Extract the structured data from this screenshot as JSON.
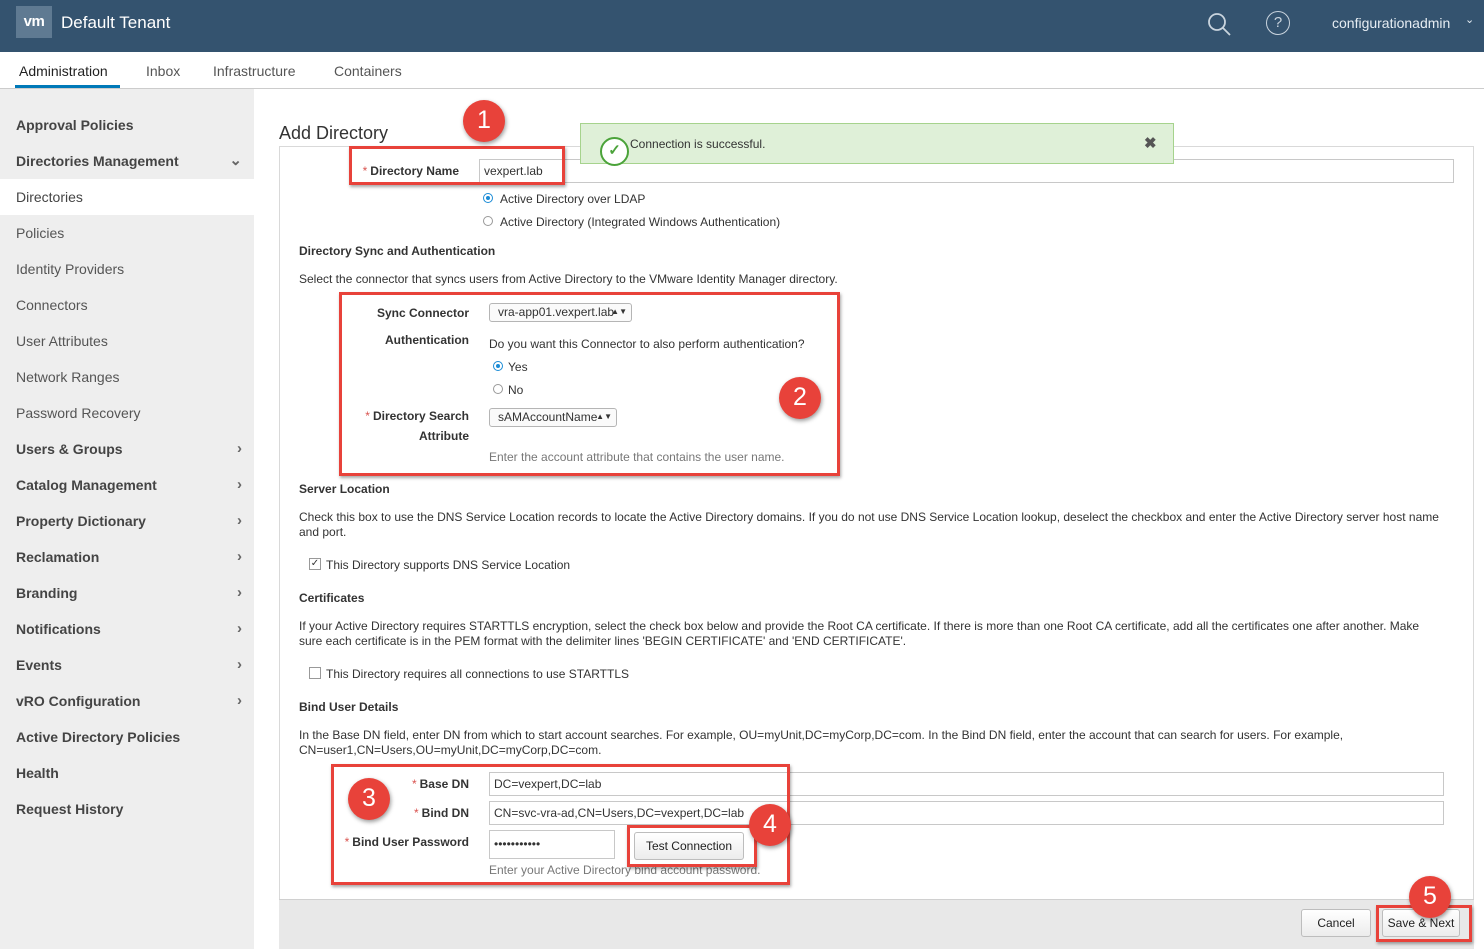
{
  "header": {
    "logo": "vm",
    "tenant": "Default Tenant",
    "search_icon": "search-icon",
    "help_icon": "help-icon",
    "help_glyph": "?",
    "username": "configurationadmin",
    "user_chevron": "⌄",
    "brand_color": "#34536f"
  },
  "tabs": [
    {
      "label": "Administration",
      "active": true
    },
    {
      "label": "Inbox"
    },
    {
      "label": "Infrastructure"
    },
    {
      "label": "Containers"
    }
  ],
  "sidebar": {
    "items": [
      {
        "label": "Approval Policies",
        "bold": true
      },
      {
        "label": "Directories Management",
        "bold": true,
        "chevron": "⌄"
      },
      {
        "label": "Directories",
        "selected": true
      },
      {
        "label": "Policies"
      },
      {
        "label": "Identity Providers"
      },
      {
        "label": "Connectors"
      },
      {
        "label": "User Attributes"
      },
      {
        "label": "Network Ranges"
      },
      {
        "label": "Password Recovery"
      },
      {
        "label": "Users & Groups",
        "bold": true,
        "chevron": "›"
      },
      {
        "label": "Catalog Management",
        "bold": true,
        "chevron": "›"
      },
      {
        "label": "Property Dictionary",
        "bold": true,
        "chevron": "›"
      },
      {
        "label": "Reclamation",
        "bold": true,
        "chevron": "›"
      },
      {
        "label": "Branding",
        "bold": true,
        "chevron": "›"
      },
      {
        "label": "Notifications",
        "bold": true,
        "chevron": "›"
      },
      {
        "label": "Events",
        "bold": true,
        "chevron": "›"
      },
      {
        "label": "vRO Configuration",
        "bold": true,
        "chevron": "›"
      },
      {
        "label": "Active Directory Policies",
        "bold": true
      },
      {
        "label": "Health",
        "bold": true
      },
      {
        "label": "Request History",
        "bold": true
      }
    ]
  },
  "page": {
    "title": "Add Directory",
    "required_mark": "*"
  },
  "toast": {
    "message": "Connection is successful.",
    "check_glyph": "✓",
    "close_glyph": "✖",
    "color": "#dff0d8"
  },
  "form": {
    "directory_name_label": "Directory Name",
    "directory_name_value": "vexpert.lab",
    "type_options": [
      {
        "label": "Active Directory over LDAP",
        "selected": true
      },
      {
        "label": "Active Directory (Integrated Windows Authentication)",
        "selected": false
      }
    ],
    "sync": {
      "heading": "Directory Sync and Authentication",
      "description": "Select the connector that syncs users from Active Directory to the VMware Identity Manager directory.",
      "sync_connector_label": "Sync Connector",
      "sync_connector_value": "vra-app01.vexpert.lab",
      "authentication_label": "Authentication",
      "auth_question": "Do you want this Connector to also perform authentication?",
      "auth_yes": "Yes",
      "auth_no": "No",
      "search_attr_label_1": "Directory Search",
      "search_attr_label_2": "Attribute",
      "search_attr_value": "sAMAccountName",
      "search_attr_hint": "Enter the account attribute that contains the user name.",
      "select_arrows": "▲▼"
    },
    "server_location": {
      "heading": "Server Location",
      "description_1": "Check this box to use the DNS Service Location records to locate the Active Directory domains. If you do not use DNS Service Location lookup, deselect the checkbox and enter the Active Directory server host name",
      "description_2": "and port.",
      "checkbox_label": "This Directory supports DNS Service Location",
      "checked": true,
      "check_glyph": "✓"
    },
    "certificates": {
      "heading": "Certificates",
      "description_1": "If your Active Directory requires STARTTLS encryption, select the check box below and provide the Root CA certificate. If there is more than one Root CA certificate, add all the certificates one after another. Make",
      "description_2": "sure each certificate is in the PEM format with the delimiter lines 'BEGIN CERTIFICATE' and 'END CERTIFICATE'.",
      "checkbox_label": "This Directory requires all connections to use STARTTLS",
      "checked": false
    },
    "bind": {
      "heading": "Bind User Details",
      "description_1": "In the Base DN field, enter DN from which to start account searches. For example, OU=myUnit,DC=myCorp,DC=com. In the Bind DN field, enter the account that can search for users. For example,",
      "description_2": "CN=user1,CN=Users,OU=myUnit,DC=myCorp,DC=com.",
      "base_dn_label": "Base DN",
      "base_dn_value": "DC=vexpert,DC=lab",
      "bind_dn_label": "Bind DN",
      "bind_dn_value": "CN=svc-vra-ad,CN=Users,DC=vexpert,DC=lab",
      "password_label": "Bind User Password",
      "password_value": "•••••••••••",
      "test_button": "Test Connection",
      "password_hint": "Enter your Active Directory bind account password."
    }
  },
  "footer": {
    "cancel": "Cancel",
    "save_next": "Save & Next"
  },
  "annotations": {
    "badges": [
      "1",
      "2",
      "3",
      "4",
      "5"
    ],
    "color": "#e8423a"
  }
}
